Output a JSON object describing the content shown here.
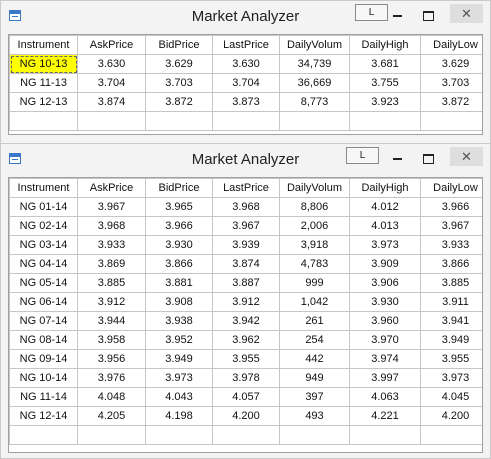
{
  "windows": [
    {
      "title": "Market Analyzer",
      "link_button": "L",
      "columns": [
        "Instrument",
        "AskPrice",
        "BidPrice",
        "LastPrice",
        "DailyVolum",
        "DailyHigh",
        "DailyLow"
      ],
      "rows": [
        [
          "NG 10-13",
          "3.630",
          "3.629",
          "3.630",
          "34,739",
          "3.681",
          "3.629"
        ],
        [
          "NG 11-13",
          "3.704",
          "3.703",
          "3.704",
          "36,669",
          "3.755",
          "3.703"
        ],
        [
          "NG 12-13",
          "3.874",
          "3.872",
          "3.873",
          "8,773",
          "3.923",
          "3.872"
        ]
      ],
      "selected_cell": "NG 10-13"
    },
    {
      "title": "Market Analyzer",
      "link_button": "L",
      "columns": [
        "Instrument",
        "AskPrice",
        "BidPrice",
        "LastPrice",
        "DailyVolum",
        "DailyHigh",
        "DailyLow"
      ],
      "rows": [
        [
          "NG 01-14",
          "3.967",
          "3.965",
          "3.968",
          "8,806",
          "4.012",
          "3.966"
        ],
        [
          "NG 02-14",
          "3.968",
          "3.966",
          "3.967",
          "2,006",
          "4.013",
          "3.967"
        ],
        [
          "NG 03-14",
          "3.933",
          "3.930",
          "3.939",
          "3,918",
          "3.973",
          "3.933"
        ],
        [
          "NG 04-14",
          "3.869",
          "3.866",
          "3.874",
          "4,783",
          "3.909",
          "3.866"
        ],
        [
          "NG 05-14",
          "3.885",
          "3.881",
          "3.887",
          "999",
          "3.906",
          "3.885"
        ],
        [
          "NG 06-14",
          "3.912",
          "3.908",
          "3.912",
          "1,042",
          "3.930",
          "3.911"
        ],
        [
          "NG 07-14",
          "3.944",
          "3.938",
          "3.942",
          "261",
          "3.960",
          "3.941"
        ],
        [
          "NG 08-14",
          "3.958",
          "3.952",
          "3.962",
          "254",
          "3.970",
          "3.949"
        ],
        [
          "NG 09-14",
          "3.956",
          "3.949",
          "3.955",
          "442",
          "3.974",
          "3.955"
        ],
        [
          "NG 10-14",
          "3.976",
          "3.973",
          "3.978",
          "949",
          "3.997",
          "3.973"
        ],
        [
          "NG 11-14",
          "4.048",
          "4.043",
          "4.057",
          "397",
          "4.063",
          "4.045"
        ],
        [
          "NG 12-14",
          "4.205",
          "4.198",
          "4.200",
          "493",
          "4.221",
          "4.200"
        ]
      ]
    }
  ],
  "colors": {
    "highlight": "#ffff00",
    "window_bg": "#f3f3f3",
    "grid_border": "#c6c6c6",
    "icon_accent": "#3a78c8"
  },
  "icons": {
    "app": "window-app-icon",
    "minimize": "minimize-icon",
    "maximize": "maximize-icon",
    "close": "close-icon"
  }
}
